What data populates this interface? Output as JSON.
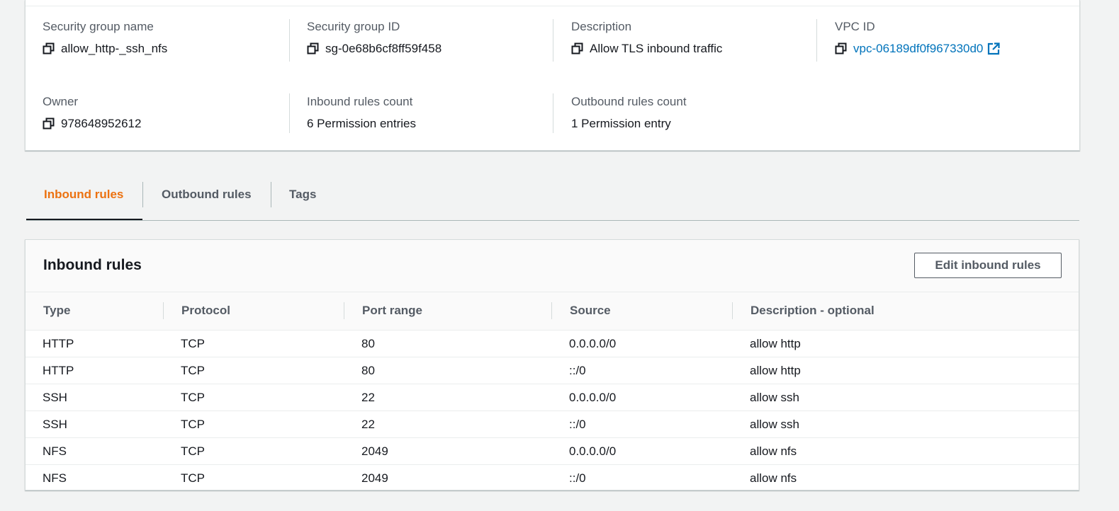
{
  "details": {
    "sg_name_label": "Security group name",
    "sg_name_value": "allow_http-_ssh_nfs",
    "sg_id_label": "Security group ID",
    "sg_id_value": "sg-0e68b6cf8ff59f458",
    "description_label": "Description",
    "description_value": "Allow TLS inbound traffic",
    "vpc_label": "VPC ID",
    "vpc_value": "vpc-06189df0f967330d0",
    "owner_label": "Owner",
    "owner_value": "978648952612",
    "inbound_count_label": "Inbound rules count",
    "inbound_count_value": "6 Permission entries",
    "outbound_count_label": "Outbound rules count",
    "outbound_count_value": "1 Permission entry"
  },
  "tabs": [
    {
      "label": "Inbound rules",
      "active": true
    },
    {
      "label": "Outbound rules",
      "active": false
    },
    {
      "label": "Tags",
      "active": false
    }
  ],
  "inbound": {
    "title": "Inbound rules",
    "edit_label": "Edit inbound rules",
    "columns": [
      "Type",
      "Protocol",
      "Port range",
      "Source",
      "Description - optional"
    ],
    "rows": [
      [
        "HTTP",
        "TCP",
        "80",
        "0.0.0.0/0",
        "allow http"
      ],
      [
        "HTTP",
        "TCP",
        "80",
        "::/0",
        "allow http"
      ],
      [
        "SSH",
        "TCP",
        "22",
        "0.0.0.0/0",
        "allow ssh"
      ],
      [
        "SSH",
        "TCP",
        "22",
        "::/0",
        "allow ssh"
      ],
      [
        "NFS",
        "TCP",
        "2049",
        "0.0.0.0/0",
        "allow nfs"
      ],
      [
        "NFS",
        "TCP",
        "2049",
        "::/0",
        "allow nfs"
      ]
    ]
  },
  "icons": {
    "copy": "copy-icon",
    "external_link": "external-link-icon"
  },
  "colors": {
    "link": "#0073bb",
    "active_tab": "#ec7211",
    "background": "#f2f3f3"
  }
}
